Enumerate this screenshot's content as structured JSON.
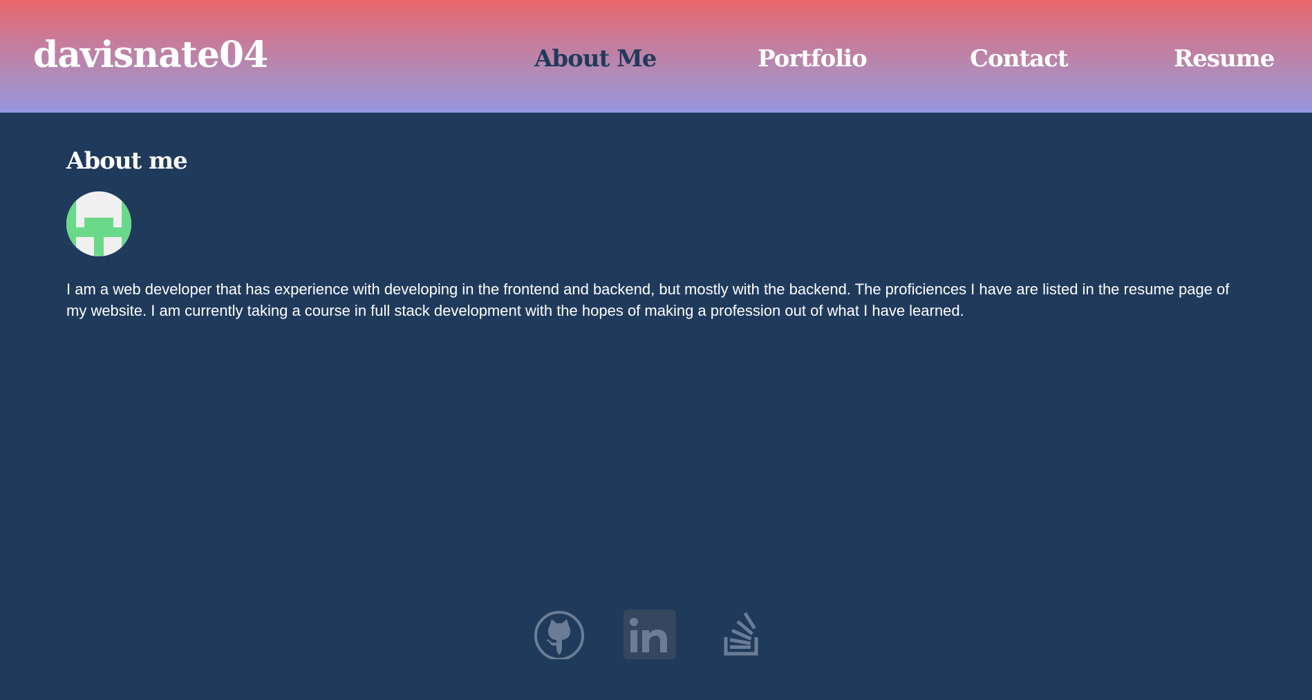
{
  "header": {
    "site_title": "davisnate04",
    "nav": [
      {
        "label": "About Me",
        "active": true
      },
      {
        "label": "Portfolio",
        "active": false
      },
      {
        "label": "Contact",
        "active": false
      },
      {
        "label": "Resume",
        "active": false
      }
    ],
    "gradient_colors": [
      "#e9666a",
      "#9696e0"
    ]
  },
  "main": {
    "section_title": "About me",
    "avatar_icon": "identicon-avatar",
    "bio": "I am a web developer that has experience with developing in the frontend and backend, but mostly with the backend. The proficiences I have are listed in the resume page of my website. I am currently taking a course in full stack development with the hopes of making a profession out of what I have learned."
  },
  "footer": {
    "social_links": [
      {
        "icon": "github-icon"
      },
      {
        "icon": "linkedin-icon"
      },
      {
        "icon": "stackoverflow-icon"
      }
    ]
  },
  "colors": {
    "background": "#203a5c",
    "active_nav_text": "#203a5c",
    "text": "#ffffff",
    "social_icon": "#6b7d96",
    "avatar_green": "#6ad98a"
  }
}
